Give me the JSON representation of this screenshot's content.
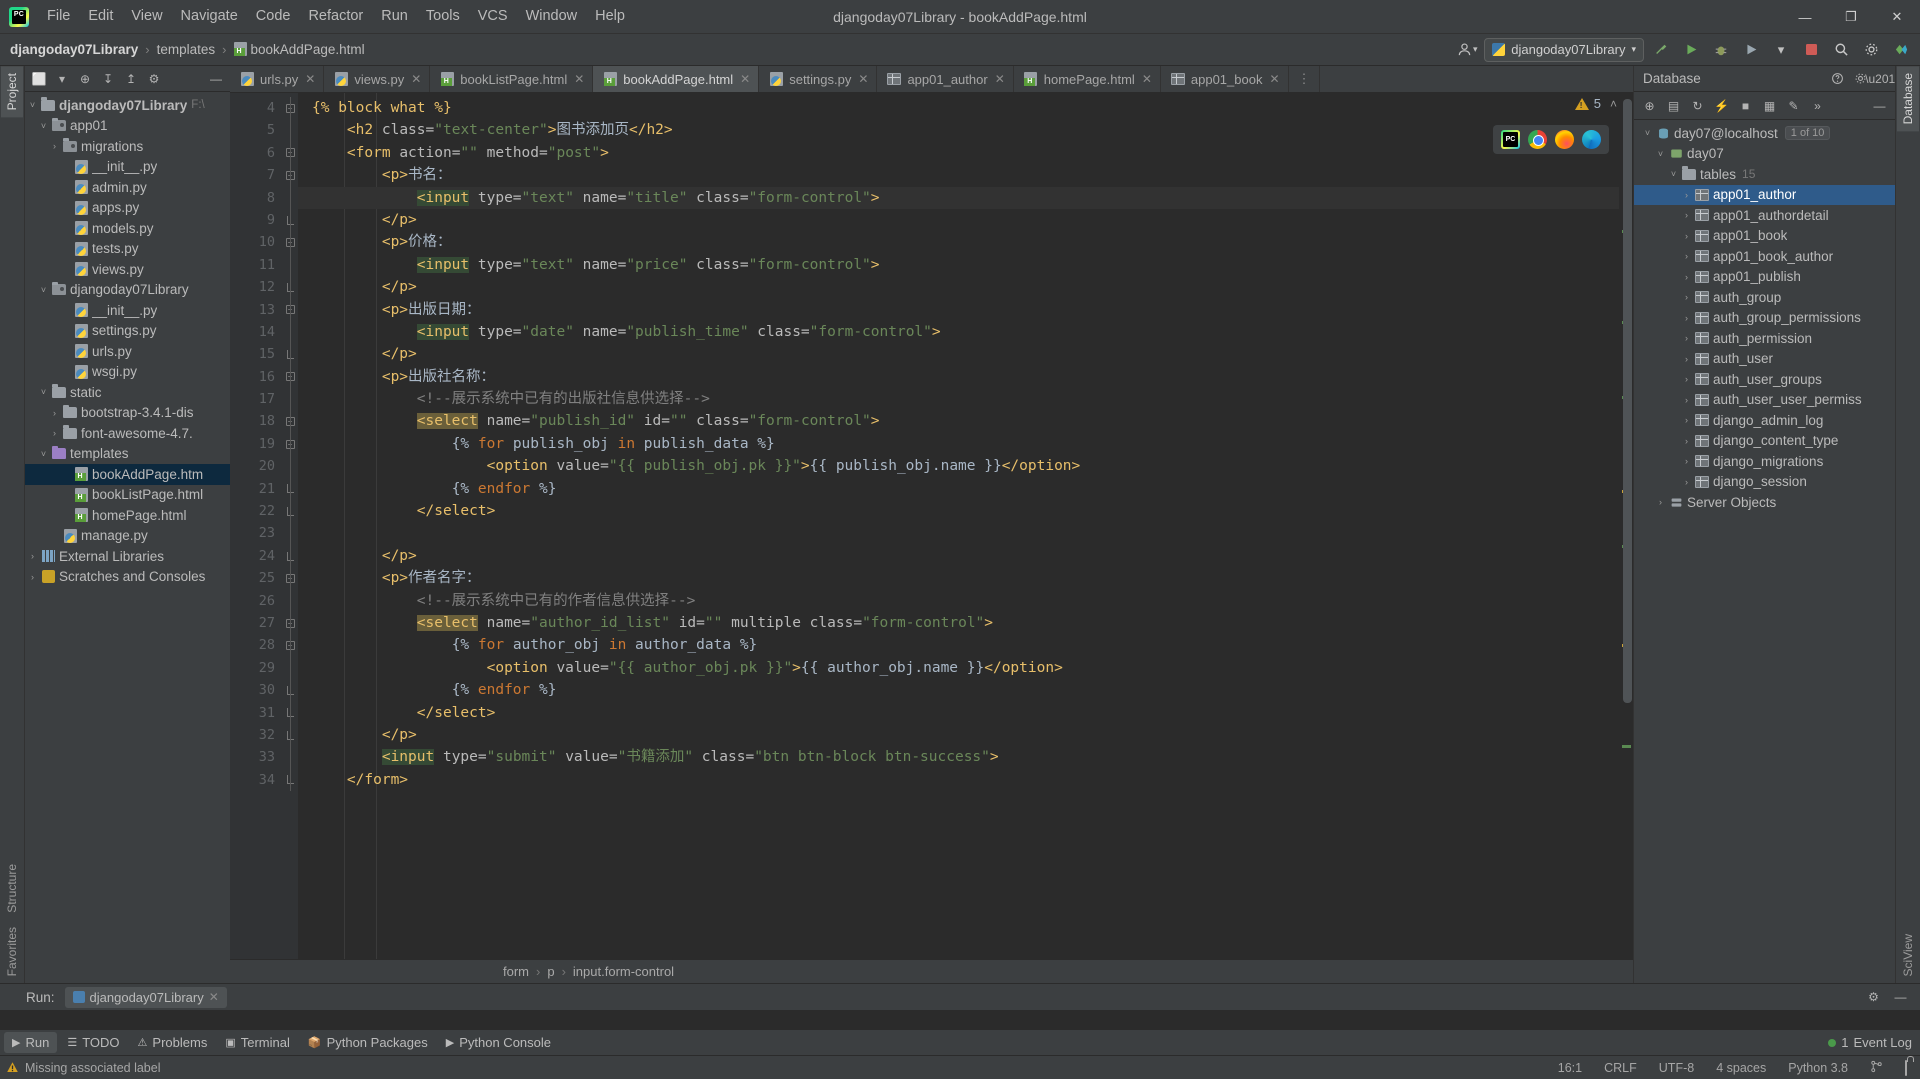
{
  "window": {
    "title": "djangoday07Library - bookAddPage.html",
    "minimize": "—",
    "maximize": "❐",
    "close": "✕"
  },
  "menu": [
    "File",
    "Edit",
    "View",
    "Navigate",
    "Code",
    "Refactor",
    "Run",
    "Tools",
    "VCS",
    "Window",
    "Help"
  ],
  "breadcrumb": {
    "project": "djangoday07Library",
    "folder": "templates",
    "file": "bookAddPage.html",
    "sep": "›"
  },
  "navbar_right": {
    "account_icon": "👤",
    "run_config": "djangoday07Library",
    "chevron": "▾",
    "build_icon": "🔨",
    "run_icon": "▶",
    "debug_icon": "🐞",
    "coverage_icon": "▶",
    "more_icon": "▾",
    "stop_icon": "■",
    "search_icon": "🔍",
    "settings_icon": "⚙"
  },
  "left_strip": {
    "project_tab": "Project",
    "structure_tab": "Structure",
    "favorites_tab": "Favorites"
  },
  "right_strip": {
    "database_tab": "Database",
    "sciview_tab": "SciView"
  },
  "project_panel": {
    "toolbar": [
      "⬜",
      "▾",
      "⊕",
      "↧",
      "↥",
      "⚙",
      "—"
    ],
    "tree": [
      {
        "depth": 0,
        "arrow": "˅",
        "icon": "folder",
        "label": "djangoday07Library",
        "path": "F:\\",
        "bold": true
      },
      {
        "depth": 1,
        "arrow": "˅",
        "icon": "module",
        "label": "app01",
        "path": "",
        "bold": false
      },
      {
        "depth": 2,
        "arrow": "›",
        "icon": "module",
        "label": "migrations",
        "path": "",
        "bold": false
      },
      {
        "depth": 3,
        "arrow": "",
        "icon": "python",
        "label": "__init__.py",
        "path": "",
        "bold": false
      },
      {
        "depth": 3,
        "arrow": "",
        "icon": "python",
        "label": "admin.py",
        "path": "",
        "bold": false
      },
      {
        "depth": 3,
        "arrow": "",
        "icon": "python",
        "label": "apps.py",
        "path": "",
        "bold": false
      },
      {
        "depth": 3,
        "arrow": "",
        "icon": "python",
        "label": "models.py",
        "path": "",
        "bold": false
      },
      {
        "depth": 3,
        "arrow": "",
        "icon": "python",
        "label": "tests.py",
        "path": "",
        "bold": false
      },
      {
        "depth": 3,
        "arrow": "",
        "icon": "python",
        "label": "views.py",
        "path": "",
        "bold": false
      },
      {
        "depth": 1,
        "arrow": "˅",
        "icon": "module",
        "label": "djangoday07Library",
        "path": "",
        "bold": false
      },
      {
        "depth": 3,
        "arrow": "",
        "icon": "python",
        "label": "__init__.py",
        "path": "",
        "bold": false
      },
      {
        "depth": 3,
        "arrow": "",
        "icon": "python",
        "label": "settings.py",
        "path": "",
        "bold": false
      },
      {
        "depth": 3,
        "arrow": "",
        "icon": "python",
        "label": "urls.py",
        "path": "",
        "bold": false
      },
      {
        "depth": 3,
        "arrow": "",
        "icon": "python",
        "label": "wsgi.py",
        "path": "",
        "bold": false
      },
      {
        "depth": 1,
        "arrow": "˅",
        "icon": "folder",
        "label": "static",
        "path": "",
        "bold": false
      },
      {
        "depth": 2,
        "arrow": "›",
        "icon": "folder",
        "label": "bootstrap-3.4.1-dis",
        "path": "",
        "bold": false
      },
      {
        "depth": 2,
        "arrow": "›",
        "icon": "folder",
        "label": "font-awesome-4.7.",
        "path": "",
        "bold": false
      },
      {
        "depth": 1,
        "arrow": "˅",
        "icon": "folder-purple",
        "label": "templates",
        "path": "",
        "bold": false
      },
      {
        "depth": 3,
        "arrow": "",
        "icon": "html",
        "label": "bookAddPage.htm",
        "path": "",
        "bold": false,
        "selected": true
      },
      {
        "depth": 3,
        "arrow": "",
        "icon": "html",
        "label": "bookListPage.html",
        "path": "",
        "bold": false
      },
      {
        "depth": 3,
        "arrow": "",
        "icon": "html",
        "label": "homePage.html",
        "path": "",
        "bold": false
      },
      {
        "depth": 2,
        "arrow": "",
        "icon": "python",
        "label": "manage.py",
        "path": "",
        "bold": false
      },
      {
        "depth": 0,
        "arrow": "›",
        "icon": "library",
        "label": "External Libraries",
        "path": "",
        "bold": false
      },
      {
        "depth": 0,
        "arrow": "›",
        "icon": "scratch",
        "label": "Scratches and Consoles",
        "path": "",
        "bold": false
      }
    ]
  },
  "editor_tabs": [
    {
      "label": "urls.py",
      "icon": "python",
      "active": false
    },
    {
      "label": "views.py",
      "icon": "python",
      "active": false
    },
    {
      "label": "bookListPage.html",
      "icon": "html",
      "active": false
    },
    {
      "label": "bookAddPage.html",
      "icon": "html",
      "active": true
    },
    {
      "label": "settings.py",
      "icon": "python",
      "active": false
    },
    {
      "label": "app01_author",
      "icon": "table",
      "active": false
    },
    {
      "label": "homePage.html",
      "icon": "html",
      "active": false
    },
    {
      "label": "app01_book",
      "icon": "table",
      "active": false
    }
  ],
  "editor": {
    "first_line": 4,
    "warning_count": "5",
    "warning_collapse_icon": "˄",
    "browser_preview": [
      "pycharm-icon",
      "chrome-icon",
      "firefox-icon",
      "edge-icon"
    ],
    "lines": [
      {
        "n": 4,
        "fold": "minus",
        "html": "<span class=\"tag\">{% block what %}</span>"
      },
      {
        "n": 5,
        "fold": "",
        "html": "    <span class=\"tag\">&lt;h2</span> <span class=\"attr\">class=</span><span class=\"str\">\"text-center\"</span><span class=\"tag\">&gt;</span><span class=\"txt\">图书添加页</span><span class=\"tag\">&lt;/h2&gt;</span>"
      },
      {
        "n": 6,
        "fold": "minus",
        "html": "    <span class=\"tag\">&lt;form</span> <span class=\"attr\">action=</span><span class=\"str\">\"\"</span> <span class=\"attr\">method=</span><span class=\"str\">\"post\"</span><span class=\"tag\">&gt;</span>"
      },
      {
        "n": 7,
        "fold": "minus",
        "html": "        <span class=\"tag\">&lt;p&gt;</span><span class=\"txt\">书名：</span>"
      },
      {
        "n": 8,
        "fold": "",
        "cur": true,
        "html": "            <span class=\"tag hl-input\">&lt;input</span> <span class=\"attr\">type=</span><span class=\"str\">\"text\"</span> <span class=\"attr\">name=</span><span class=\"str\">\"title\"</span> <span class=\"attr\">class=</span><span class=\"str\">\"form-control\"</span><span class=\"tag\">&gt;</span>"
      },
      {
        "n": 9,
        "fold": "end",
        "html": "        <span class=\"tag\">&lt;/p&gt;</span>"
      },
      {
        "n": 10,
        "fold": "minus",
        "html": "        <span class=\"tag\">&lt;p&gt;</span><span class=\"txt\">价格：</span>"
      },
      {
        "n": 11,
        "fold": "",
        "html": "            <span class=\"tag hl-input\">&lt;input</span> <span class=\"attr\">type=</span><span class=\"str\">\"text\"</span> <span class=\"attr\">name=</span><span class=\"str\">\"price\"</span> <span class=\"attr\">class=</span><span class=\"str\">\"form-control\"</span><span class=\"tag\">&gt;</span>"
      },
      {
        "n": 12,
        "fold": "end",
        "html": "        <span class=\"tag\">&lt;/p&gt;</span>"
      },
      {
        "n": 13,
        "fold": "minus",
        "html": "        <span class=\"tag\">&lt;p&gt;</span><span class=\"txt\">出版日期：</span>"
      },
      {
        "n": 14,
        "fold": "",
        "html": "            <span class=\"tag hl-input\">&lt;input</span> <span class=\"attr\">type=</span><span class=\"str\">\"date\"</span> <span class=\"attr\">name=</span><span class=\"str\">\"publish_time\"</span> <span class=\"attr\">class=</span><span class=\"str\">\"form-control\"</span><span class=\"tag\">&gt;</span>"
      },
      {
        "n": 15,
        "fold": "end",
        "html": "        <span class=\"tag\">&lt;/p&gt;</span>"
      },
      {
        "n": 16,
        "fold": "minus",
        "html": "        <span class=\"tag\">&lt;p&gt;</span><span class=\"txt\">出版社名称：</span>"
      },
      {
        "n": 17,
        "fold": "",
        "html": "            <span class=\"cmt\">&lt;!--展示系统中已有的出版社信息供选择--&gt;</span>"
      },
      {
        "n": 18,
        "fold": "minus",
        "html": "            <span class=\"tag hl-select\">&lt;select</span> <span class=\"attr\">name=</span><span class=\"str\">\"publish_id\"</span> <span class=\"attr\">id=</span><span class=\"str\">\"\"</span> <span class=\"attr\">class=</span><span class=\"str\">\"form-control\"</span><span class=\"tag\">&gt;</span>"
      },
      {
        "n": 19,
        "fold": "minus",
        "html": "                <span class=\"dj\">{% </span><span class=\"kw\">for</span><span class=\"dj\"> publish_obj </span><span class=\"kw\">in</span><span class=\"dj\"> publish_data %}</span>"
      },
      {
        "n": 20,
        "fold": "",
        "html": "                    <span class=\"tag\">&lt;option</span> <span class=\"attr\">value=</span><span class=\"str\">\"{{ publish_obj.pk }}\"</span><span class=\"tag\">&gt;</span><span class=\"dj\">{{ publish_obj.name }}</span><span class=\"tag\">&lt;/option&gt;</span>"
      },
      {
        "n": 21,
        "fold": "end",
        "html": "                <span class=\"dj\">{% </span><span class=\"kw\">endfor</span><span class=\"dj\"> %}</span>"
      },
      {
        "n": 22,
        "fold": "end",
        "html": "            <span class=\"tag\">&lt;/select&gt;</span>"
      },
      {
        "n": 23,
        "fold": "",
        "html": ""
      },
      {
        "n": 24,
        "fold": "end",
        "html": "        <span class=\"tag\">&lt;/p&gt;</span>"
      },
      {
        "n": 25,
        "fold": "minus",
        "html": "        <span class=\"tag\">&lt;p&gt;</span><span class=\"txt\">作者名字：</span>"
      },
      {
        "n": 26,
        "fold": "",
        "html": "            <span class=\"cmt\">&lt;!--展示系统中已有的作者信息供选择--&gt;</span>"
      },
      {
        "n": 27,
        "fold": "minus",
        "html": "            <span class=\"tag hl-select\">&lt;select</span> <span class=\"attr\">name=</span><span class=\"str\">\"author_id_list\"</span> <span class=\"attr\">id=</span><span class=\"str\">\"\"</span> <span class=\"attr\">multiple</span> <span class=\"attr\">class=</span><span class=\"str\">\"form-control\"</span><span class=\"tag\">&gt;</span>"
      },
      {
        "n": 28,
        "fold": "minus",
        "html": "                <span class=\"dj\">{% </span><span class=\"kw\">for</span><span class=\"dj\"> author_obj </span><span class=\"kw\">in</span><span class=\"dj\"> author_data %}</span>"
      },
      {
        "n": 29,
        "fold": "",
        "html": "                    <span class=\"tag\">&lt;option</span> <span class=\"attr\">value=</span><span class=\"str\">\"{{ author_obj.pk }}\"</span><span class=\"tag\">&gt;</span><span class=\"dj\">{{ author_obj.name }}</span><span class=\"tag\">&lt;/option&gt;</span>"
      },
      {
        "n": 30,
        "fold": "end",
        "html": "                <span class=\"dj\">{% </span><span class=\"kw\">endfor</span><span class=\"dj\"> %}</span>"
      },
      {
        "n": 31,
        "fold": "end",
        "html": "            <span class=\"tag\">&lt;/select&gt;</span>"
      },
      {
        "n": 32,
        "fold": "end",
        "html": "        <span class=\"tag\">&lt;/p&gt;</span>"
      },
      {
        "n": 33,
        "fold": "",
        "html": "        <span class=\"tag hl-input\">&lt;input</span> <span class=\"attr\">type=</span><span class=\"str\">\"submit\"</span> <span class=\"attr\">value=</span><span class=\"str\">\"书籍添加\"</span> <span class=\"attr\">class=</span><span class=\"str\">\"btn btn-block btn-success\"</span><span class=\"tag\">&gt;</span>"
      },
      {
        "n": 34,
        "fold": "end",
        "html": "    <span class=\"tag\">&lt;/form&gt;</span>"
      }
    ]
  },
  "editor_breadcrumb": {
    "items": [
      "form",
      "p",
      "input.form-control"
    ],
    "sep": "›"
  },
  "database_panel": {
    "title": "Database",
    "toolbar": [
      "⊕",
      "▤",
      "↻",
      "⚡",
      "■",
      "▦",
      "✎",
      "»",
      "—"
    ],
    "tree": [
      {
        "depth": 0,
        "arrow": "˅",
        "icon": "db",
        "label": "day07@localhost",
        "badge": "1 of 10",
        "count": "",
        "sel": false
      },
      {
        "depth": 1,
        "arrow": "˅",
        "icon": "schema",
        "label": "day07",
        "badge": "",
        "count": "",
        "sel": false
      },
      {
        "depth": 2,
        "arrow": "˅",
        "icon": "folder",
        "label": "tables",
        "badge": "",
        "count": "15",
        "sel": false
      },
      {
        "depth": 3,
        "arrow": "›",
        "icon": "table",
        "label": "app01_author",
        "badge": "",
        "count": "",
        "sel": true
      },
      {
        "depth": 3,
        "arrow": "›",
        "icon": "table",
        "label": "app01_authordetail",
        "badge": "",
        "count": "",
        "sel": false
      },
      {
        "depth": 3,
        "arrow": "›",
        "icon": "table",
        "label": "app01_book",
        "badge": "",
        "count": "",
        "sel": false
      },
      {
        "depth": 3,
        "arrow": "›",
        "icon": "table",
        "label": "app01_book_author",
        "badge": "",
        "count": "",
        "sel": false
      },
      {
        "depth": 3,
        "arrow": "›",
        "icon": "table",
        "label": "app01_publish",
        "badge": "",
        "count": "",
        "sel": false
      },
      {
        "depth": 3,
        "arrow": "›",
        "icon": "table",
        "label": "auth_group",
        "badge": "",
        "count": "",
        "sel": false
      },
      {
        "depth": 3,
        "arrow": "›",
        "icon": "table",
        "label": "auth_group_permissions",
        "badge": "",
        "count": "",
        "sel": false
      },
      {
        "depth": 3,
        "arrow": "›",
        "icon": "table",
        "label": "auth_permission",
        "badge": "",
        "count": "",
        "sel": false
      },
      {
        "depth": 3,
        "arrow": "›",
        "icon": "table",
        "label": "auth_user",
        "badge": "",
        "count": "",
        "sel": false
      },
      {
        "depth": 3,
        "arrow": "›",
        "icon": "table",
        "label": "auth_user_groups",
        "badge": "",
        "count": "",
        "sel": false
      },
      {
        "depth": 3,
        "arrow": "›",
        "icon": "table",
        "label": "auth_user_user_permiss",
        "badge": "",
        "count": "",
        "sel": false
      },
      {
        "depth": 3,
        "arrow": "›",
        "icon": "table",
        "label": "django_admin_log",
        "badge": "",
        "count": "",
        "sel": false
      },
      {
        "depth": 3,
        "arrow": "›",
        "icon": "table",
        "label": "django_content_type",
        "badge": "",
        "count": "",
        "sel": false
      },
      {
        "depth": 3,
        "arrow": "›",
        "icon": "table",
        "label": "django_migrations",
        "badge": "",
        "count": "",
        "sel": false
      },
      {
        "depth": 3,
        "arrow": "›",
        "icon": "table",
        "label": "django_session",
        "badge": "",
        "count": "",
        "sel": false
      },
      {
        "depth": 1,
        "arrow": "›",
        "icon": "server",
        "label": "Server Objects",
        "badge": "",
        "count": "",
        "sel": false
      }
    ]
  },
  "run_panel": {
    "label": "Run:",
    "tab": "djangoday07Library",
    "tab_close": "✕",
    "settings_icon": "⚙",
    "minimize_icon": "—"
  },
  "toolwindow_bar": {
    "items": [
      {
        "label": "Run",
        "icon": "▶",
        "active": true
      },
      {
        "label": "TODO",
        "icon": "☰",
        "active": false
      },
      {
        "label": "Problems",
        "icon": "⚠",
        "active": false
      },
      {
        "label": "Terminal",
        "icon": "▣",
        "active": false
      },
      {
        "label": "Python Packages",
        "icon": "📦",
        "active": false
      },
      {
        "label": "Python Console",
        "icon": "▶",
        "active": false
      }
    ],
    "event_log": "Event Log",
    "event_count": "1",
    "settings_icon": "⚙",
    "hide_icon": "—"
  },
  "statusbar": {
    "message": "Missing associated label",
    "caret": "16:1",
    "line_sep": "CRLF",
    "encoding": "UTF-8",
    "indent": "4 spaces",
    "interpreter": "Python 3.8",
    "branch_icon": "⎇",
    "lock_icon": "lock-icon"
  }
}
